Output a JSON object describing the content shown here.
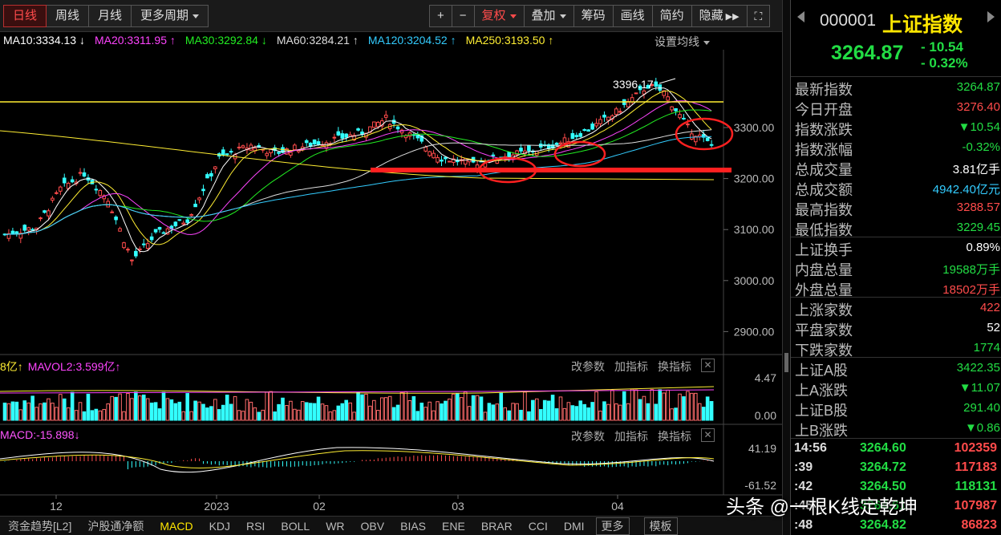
{
  "toolbar": {
    "period_tabs": [
      "日线",
      "周线",
      "月线",
      "更多周期"
    ],
    "active_tab": "日线",
    "right_tools": [
      "+",
      "−",
      "复权",
      "叠加",
      "筹码",
      "画线",
      "简约",
      "隐藏"
    ]
  },
  "ma_legend": [
    {
      "label": "MA10:3334.13",
      "arrow": "↓",
      "color": "#ffffff"
    },
    {
      "label": "MA20:3311.95",
      "arrow": "↑",
      "color": "#ff44ff"
    },
    {
      "label": "MA30:3292.84",
      "arrow": "↓",
      "color": "#22ee22"
    },
    {
      "label": "MA60:3284.21",
      "arrow": "↑",
      "color": "#dddddd"
    },
    {
      "label": "MA120:3204.52",
      "arrow": "↑",
      "color": "#33ccff"
    },
    {
      "label": "MA250:3193.50",
      "arrow": "↑",
      "color": "#ffee33"
    }
  ],
  "set_ma_label": "设置均线",
  "price_axis": [
    "3300.00",
    "3200.00",
    "3100.00",
    "3000.00",
    "2900.00"
  ],
  "high_annotation": "3396.17",
  "volume_header": {
    "mavol1": "8亿↑",
    "mavol2": "MAVOL2:3.599亿↑"
  },
  "volume_axis": [
    "4.47",
    "0.00"
  ],
  "macd_header": "MACD:-15.898↓",
  "macd_axis": [
    "41.19",
    "-61.52"
  ],
  "panel_buttons": [
    "改参数",
    "加指标",
    "换指标"
  ],
  "time_axis": [
    "12",
    "2023",
    "02",
    "03",
    "04"
  ],
  "indicator_tabs": [
    "资金趋势[L2]",
    "沪股通净额",
    "MACD",
    "KDJ",
    "RSI",
    "BOLL",
    "WR",
    "OBV",
    "BIAS",
    "ENE",
    "BRAR",
    "CCI",
    "DMI",
    "更多",
    "模板"
  ],
  "active_indicator": "MACD",
  "quote": {
    "code": "000001",
    "name": "上证指数",
    "price": "3264.87",
    "change": "- 10.54",
    "change_pct": "- 0.32%",
    "stats": [
      {
        "label": "最新指数",
        "value": "3264.87",
        "color": "#22dd44"
      },
      {
        "label": "今日开盘",
        "value": "3276.40",
        "color": "#ff4b4b"
      },
      {
        "label": "指数涨跌",
        "value": "▼10.54",
        "color": "#22dd44"
      },
      {
        "label": "指数涨幅",
        "value": "-0.32%",
        "color": "#22dd44"
      },
      {
        "label": "总成交量",
        "value": "3.81亿手",
        "color": "#ffffff"
      },
      {
        "label": "总成交额",
        "value": "4942.40亿元",
        "color": "#33ccff"
      },
      {
        "label": "最高指数",
        "value": "3288.57",
        "color": "#ff4b4b"
      },
      {
        "label": "最低指数",
        "value": "3229.45",
        "color": "#22dd44"
      },
      {
        "label": "上证换手",
        "value": "0.89%",
        "color": "#ffffff"
      },
      {
        "label": "内盘总量",
        "value": "19588万手",
        "color": "#22dd44"
      },
      {
        "label": "外盘总量",
        "value": "18502万手",
        "color": "#ff4b4b"
      },
      {
        "label": "上涨家数",
        "value": "422",
        "color": "#ff4b4b"
      },
      {
        "label": "平盘家数",
        "value": "52",
        "color": "#ffffff"
      },
      {
        "label": "下跌家数",
        "value": "1774",
        "color": "#22dd44"
      },
      {
        "label": "上证A股",
        "value": "3422.35",
        "color": "#22dd44"
      },
      {
        "label": "上A涨跌",
        "value": "▼11.07",
        "color": "#22dd44"
      },
      {
        "label": "上证B股",
        "value": "291.40",
        "color": "#22dd44"
      },
      {
        "label": "上B涨跌",
        "value": "▼0.86",
        "color": "#22dd44"
      }
    ],
    "ticks": [
      {
        "time": "14:56",
        "price": "3264.60",
        "vol": "102359",
        "color": "#ff4b4b"
      },
      {
        "time": ":39",
        "price": "3264.72",
        "vol": "117183",
        "color": "#ff4b4b"
      },
      {
        "time": ":42",
        "price": "3264.50",
        "vol": "118131",
        "color": "#22dd44"
      },
      {
        "time": ":45",
        "price": "3264.61",
        "vol": "107987",
        "color": "#ff4b4b"
      },
      {
        "time": ":48",
        "price": "3264.82",
        "vol": "86823",
        "color": "#ff4b4b"
      }
    ]
  },
  "watermark": "头条 @一根K线定乾坤"
}
